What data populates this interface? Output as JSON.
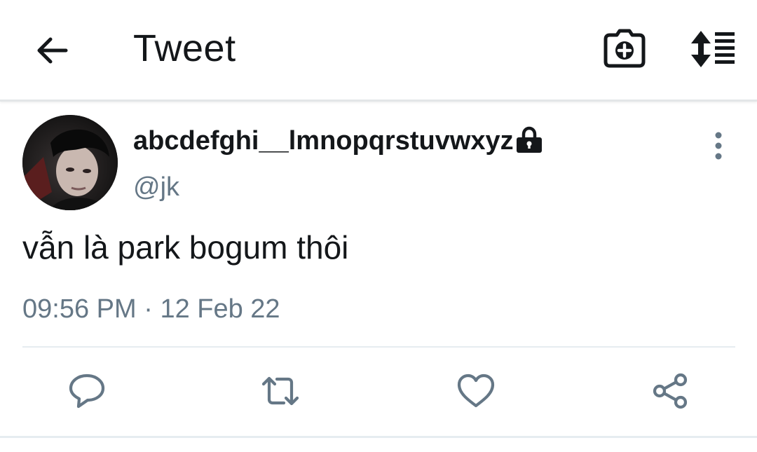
{
  "header": {
    "title": "Tweet",
    "back_icon": "arrow-left-icon",
    "camera_icon": "camera-plus-icon",
    "sort_icon": "sort-list-icon"
  },
  "tweet": {
    "display_name": "abcdefghi__lmnopqrstuvwxyz",
    "handle": "@jk",
    "protected": true,
    "text": "vẫn là park bogum thôi",
    "time": "09:56 PM",
    "separator": "·",
    "date": "12 Feb 22"
  },
  "actions": [
    "reply-icon",
    "retweet-icon",
    "like-icon",
    "share-icon"
  ],
  "colors": {
    "text_primary": "#14171a",
    "text_secondary": "#657786",
    "icon_gray": "#657786",
    "divider": "#e6ecf0"
  }
}
